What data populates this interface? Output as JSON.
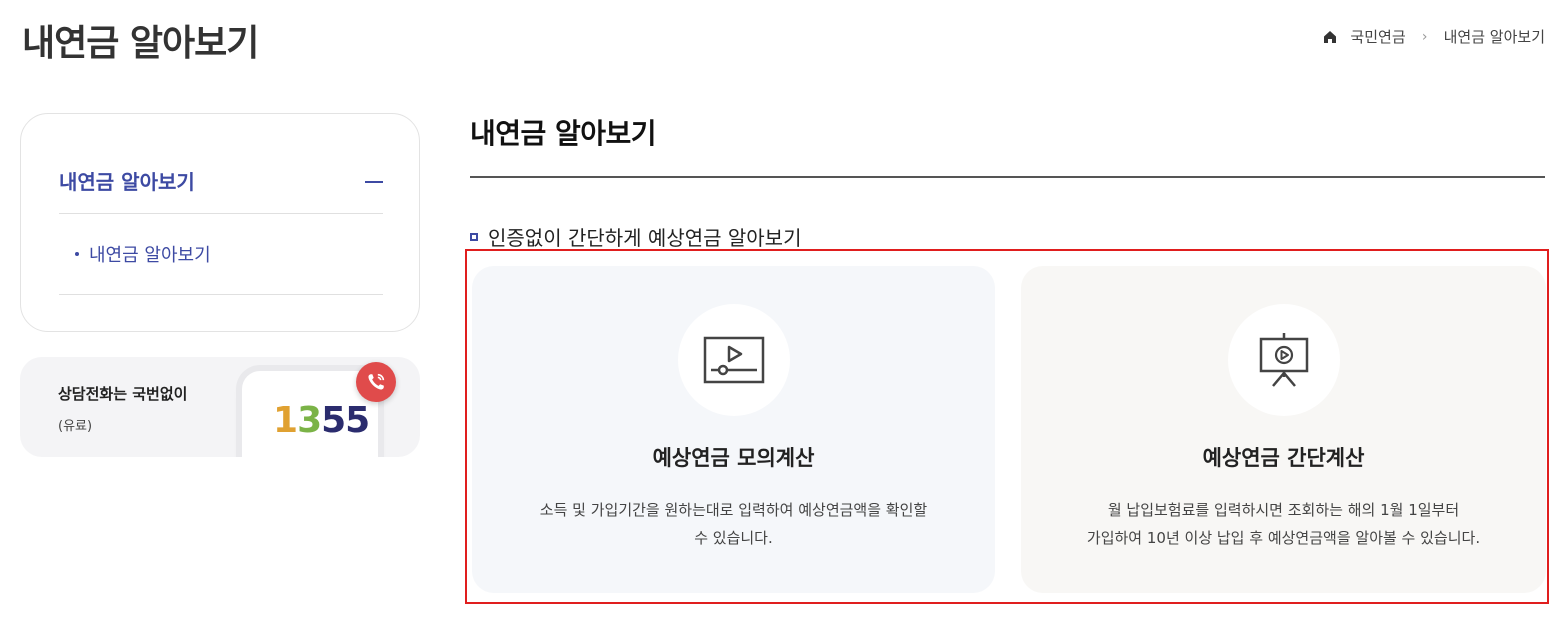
{
  "header": {
    "title": "내연금 알아보기"
  },
  "breadcrumb": {
    "items": [
      "국민연금",
      "내연금 알아보기"
    ],
    "separator": "›"
  },
  "sidebar": {
    "menu_title": "내연금 알아보기",
    "sub_items": [
      {
        "label": "내연금 알아보기"
      }
    ],
    "call": {
      "label": "상담전화는 국번없이",
      "note": "(유료)",
      "number_parts": [
        "1",
        "3",
        "55"
      ]
    }
  },
  "main": {
    "title": "내연금 알아보기",
    "subheading": "인증없이 간단하게 예상연금 알아보기",
    "cards": [
      {
        "icon": "video-play-icon",
        "title": "예상연금 모의계산",
        "desc_line1": "소득 및 가입기간을 원하는대로 입력하여 예상연금액을 확인할",
        "desc_line2": "수 있습니다."
      },
      {
        "icon": "presentation-board-icon",
        "title": "예상연금 간단계산",
        "desc_line1": "월 납입보험료를 입력하시면 조회하는 해의 1월 1일부터",
        "desc_line2": "가입하여 10년 이상 납입 후 예상연금액을 알아볼 수 있습니다."
      }
    ]
  },
  "colors": {
    "accent": "#3d4aa3",
    "highlight_border": "#e01e1e",
    "call_red": "#e04b4b"
  }
}
